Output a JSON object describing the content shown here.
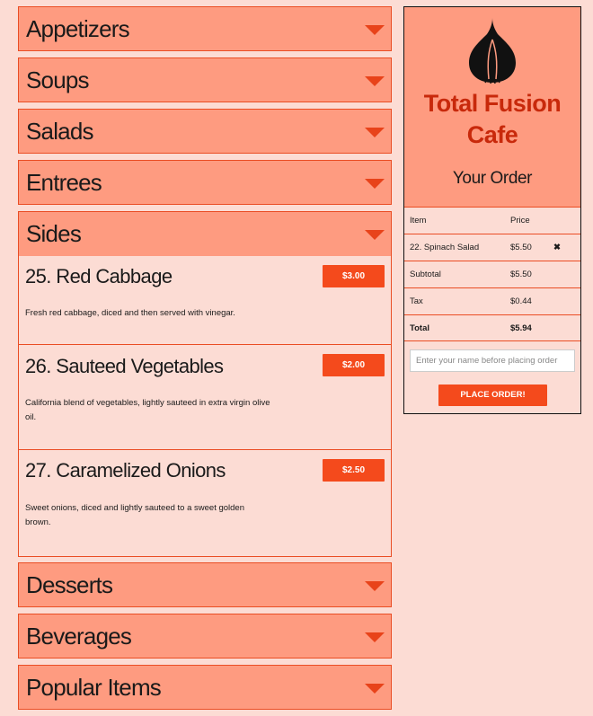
{
  "menu": {
    "categories_top": [
      {
        "label": "Appetizers"
      },
      {
        "label": "Soups"
      },
      {
        "label": "Salads"
      },
      {
        "label": "Entrees"
      }
    ],
    "sides": {
      "label": "Sides",
      "items": [
        {
          "name": "25. Red Cabbage",
          "price": "$3.00",
          "description": "Fresh red cabbage, diced and then served with vinegar."
        },
        {
          "name": "26. Sauteed Vegetables",
          "price": "$2.00",
          "description": "California blend of vegetables, lightly sauteed in extra virgin olive oil."
        },
        {
          "name": "27. Caramelized Onions",
          "price": "$2.50",
          "description": "Sweet onions, diced and lightly sauteed to a sweet golden brown."
        }
      ]
    },
    "categories_bottom": [
      {
        "label": "Desserts"
      },
      {
        "label": "Beverages"
      },
      {
        "label": "Popular Items"
      }
    ]
  },
  "order": {
    "cafe_name_line1": "Total Fusion",
    "cafe_name_line2": "Cafe",
    "heading": "Your Order",
    "columns": {
      "item": "Item",
      "price": "Price"
    },
    "items": [
      {
        "name": "22. Spinach Salad",
        "price": "$5.50",
        "remove_icon": "x-icon",
        "remove_glyph": "✖"
      }
    ],
    "subtotal_label": "Subtotal",
    "subtotal": "$5.50",
    "tax_label": "Tax",
    "tax": "$0.44",
    "total_label": "Total",
    "total": "$5.94",
    "name_placeholder": "Enter your name before placing order",
    "place_order_label": "PLACE ORDER!"
  },
  "colors": {
    "background": "#fcdcd4",
    "panel": "#fe9b80",
    "accent": "#f44a1c",
    "border": "#ea4d24",
    "brand_text": "#c8290b"
  }
}
